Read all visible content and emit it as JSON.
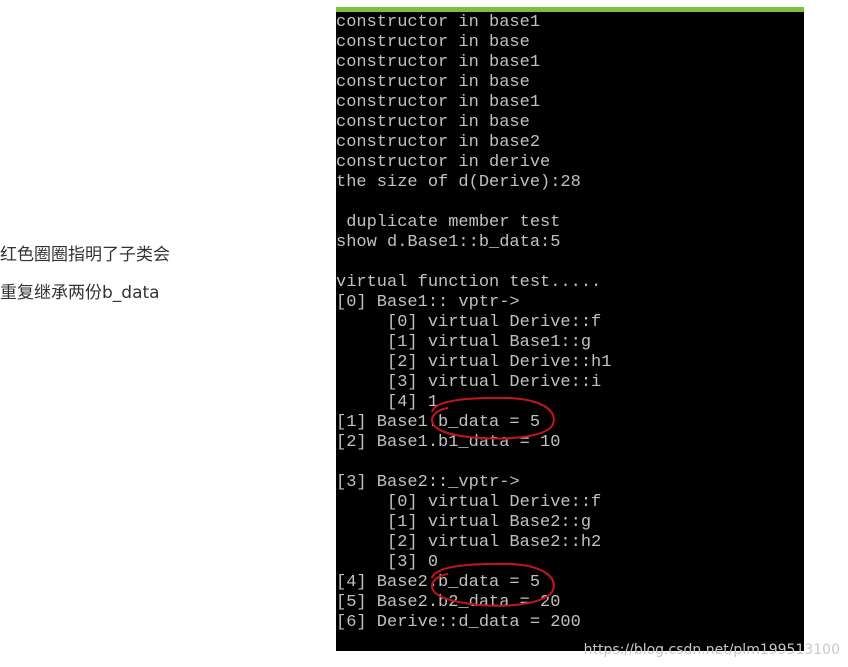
{
  "annotation": {
    "line1": "红色圈圈指明了子类会",
    "line2": "重复继承两份b_data"
  },
  "console": {
    "lines": [
      "constructor in base1",
      "constructor in base",
      "constructor in base1",
      "constructor in base",
      "constructor in base1",
      "constructor in base",
      "constructor in base2",
      "constructor in derive",
      "the size of d(Derive):28",
      "",
      " duplicate member test",
      "show d.Base1::b_data:5",
      "",
      "virtual function test.....",
      "[0] Base1:: vptr->",
      "     [0] virtual Derive::f",
      "     [1] virtual Base1::g",
      "     [2] virtual Derive::h1",
      "     [3] virtual Derive::i",
      "     [4] 1",
      "[1] Base1.b_data = 5",
      "[2] Base1.b1_data = 10",
      "",
      "[3] Base2::_vptr->",
      "     [0] virtual Derive::f",
      "     [1] virtual Base2::g",
      "     [2] virtual Base2::h2",
      "     [3] 0",
      "[4] Base2.b_data = 5",
      "[5] Base2.b2_data = 20",
      "[6] Derive::d_data = 200"
    ]
  },
  "watermark": "https://blog.csdn.net/plm199513100",
  "colors": {
    "console_bg": "#000000",
    "console_text": "#c0c0c0",
    "title_bar": "#7fbf3f",
    "circle": "#c0161c"
  }
}
